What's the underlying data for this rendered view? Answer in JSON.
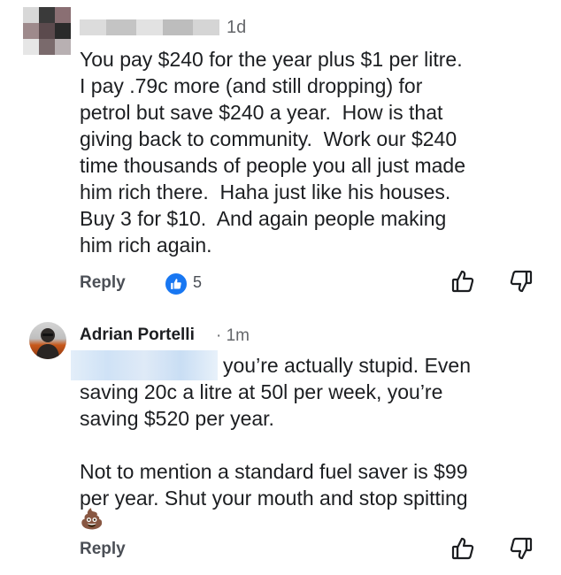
{
  "comment1": {
    "time": "1d",
    "text": "You pay $240 for the year plus $1 per litre.\nI pay .79c more (and still dropping) for\npetrol but save $240 a year.  How is that\ngiving back to community.  Work our $240\ntime thousands of people you all just made\nhim rich there.  Haha just like his houses.\nBuy 3 for $10.  And again people making\nhim rich again.",
    "reply_label": "Reply",
    "like_count": "5",
    "icons": [
      "like-badge-icon",
      "thumbs-up-icon",
      "thumbs-down-icon"
    ]
  },
  "comment2": {
    "author": "Adrian Portelli",
    "time": "· 1m",
    "text_line1": "you’re actually stupid. Even",
    "text_rest": "saving 20c a litre at 50l per week, you’re\nsaving $520 per year.\n\nNot to mention a standard fuel saver is $99\nper year. Shut your mouth and stop spitting",
    "emoji": "💩",
    "reply_label": "Reply",
    "icons": [
      "thumbs-up-icon",
      "thumbs-down-icon"
    ]
  },
  "colors": {
    "text": "#1c1e21",
    "secondary": "#65676b",
    "like_blue": "#1877f2"
  }
}
